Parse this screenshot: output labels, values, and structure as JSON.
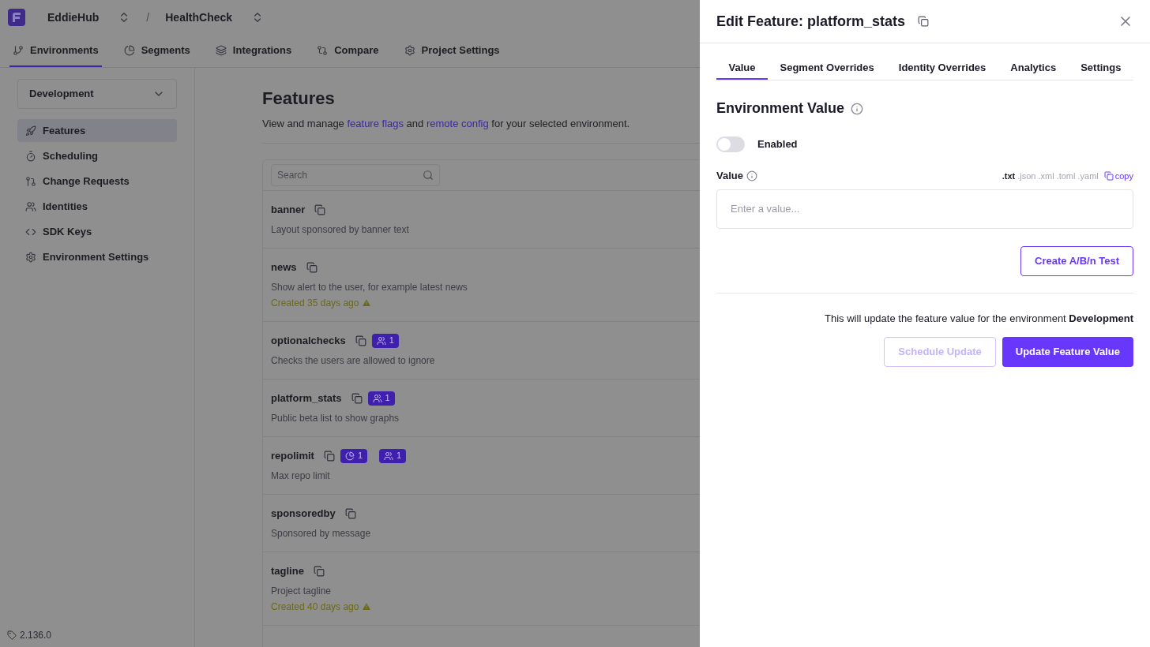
{
  "header": {
    "organisation": "EddieHub",
    "separator": "/",
    "project": "HealthCheck"
  },
  "nav_tabs": [
    {
      "label": "Environments",
      "selected": true
    },
    {
      "label": "Segments",
      "selected": false
    },
    {
      "label": "Integrations",
      "selected": false
    },
    {
      "label": "Compare",
      "selected": false
    },
    {
      "label": "Project Settings",
      "selected": false
    }
  ],
  "environment_select": {
    "value": "Development"
  },
  "sidebar": {
    "items": [
      {
        "label": "Features",
        "selected": true
      },
      {
        "label": "Scheduling",
        "selected": false
      },
      {
        "label": "Change Requests",
        "selected": false
      },
      {
        "label": "Identities",
        "selected": false
      },
      {
        "label": "SDK Keys",
        "selected": false
      },
      {
        "label": "Environment Settings",
        "selected": false
      }
    ],
    "version": "2.136.0"
  },
  "page": {
    "title": "Features",
    "description": [
      {
        "kind": "text",
        "text": "View and manage "
      },
      {
        "kind": "link",
        "text": "feature flags"
      },
      {
        "kind": "text",
        "text": " and "
      },
      {
        "kind": "link",
        "text": "remote config"
      },
      {
        "kind": "text",
        "text": " for your selected environment."
      }
    ],
    "search": {
      "placeholder": "Search"
    },
    "features": [
      {
        "name": "banner",
        "description": "Layout sponsored by banner text"
      },
      {
        "name": "news",
        "description": "Show alert to the user, for example latest news",
        "created": "Created 35 days ago"
      },
      {
        "name": "optionalchecks",
        "description": "Checks the users are allowed to ignore",
        "badges": [
          {
            "kind": "identity",
            "count": "1"
          }
        ]
      },
      {
        "name": "platform_stats",
        "description": "Public beta list to show graphs",
        "badges": [
          {
            "kind": "identity",
            "count": "1"
          }
        ]
      },
      {
        "name": "repolimit",
        "description": "Max repo limit",
        "badges": [
          {
            "kind": "segment",
            "count": "1"
          },
          {
            "kind": "identity",
            "count": "1"
          }
        ]
      },
      {
        "name": "sponsoredby",
        "description": "Sponsored by message"
      },
      {
        "name": "tagline",
        "description": "Project tagline",
        "created": "Created 40 days ago"
      }
    ]
  },
  "drawer": {
    "title": "Edit Feature: platform_stats",
    "tabs": [
      {
        "label": "Value",
        "selected": true
      },
      {
        "label": "Segment Overrides",
        "selected": false
      },
      {
        "label": "Identity Overrides",
        "selected": false
      },
      {
        "label": "Analytics",
        "selected": false
      },
      {
        "label": "Settings",
        "selected": false
      }
    ],
    "section_title": "Environment Value",
    "toggle": {
      "label": "Enabled",
      "on": false
    },
    "value_label": "Value",
    "formats": [
      {
        "label": ".txt",
        "selected": true
      },
      {
        "label": ".json",
        "selected": false
      },
      {
        "label": ".xml",
        "selected": false
      },
      {
        "label": ".toml",
        "selected": false
      },
      {
        "label": ".yaml",
        "selected": false
      }
    ],
    "copy": "copy",
    "value_placeholder": "Enter a value...",
    "ab_button": "Create A/B/n Test",
    "note": "This will update the feature value for the environment **Development**",
    "buttons": [
      {
        "label": "Schedule Update",
        "kind": "secondary",
        "disabled": true
      },
      {
        "label": "Update Feature Value",
        "kind": "primary",
        "disabled": false
      }
    ]
  }
}
